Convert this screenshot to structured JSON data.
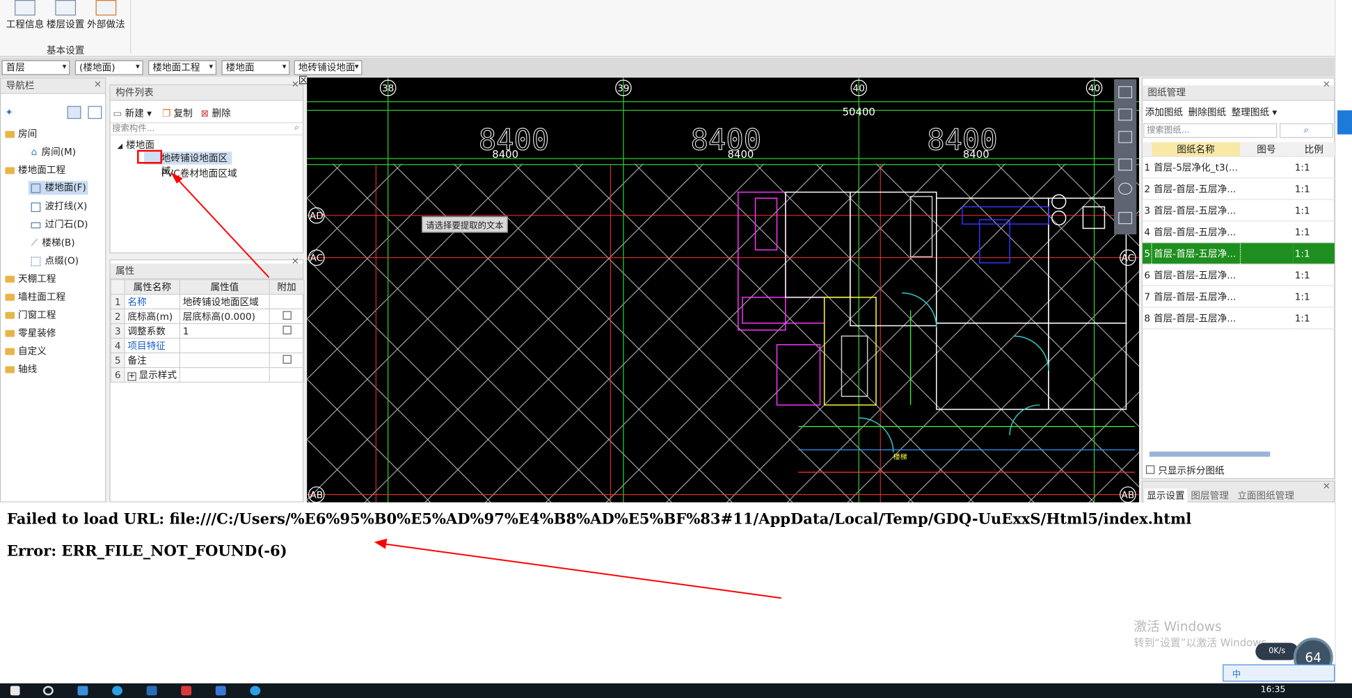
{
  "ribbon": {
    "buttons": [
      {
        "label": "工程信息",
        "icon": "project-info-icon"
      },
      {
        "label": "楼层设置",
        "icon": "floor-settings-icon"
      },
      {
        "label": "外部做法",
        "icon": "external-method-icon"
      }
    ],
    "group_label": "基本设置"
  },
  "selectors": [
    "首层",
    "(楼地面)",
    "楼地面工程",
    "楼地面",
    "地砖铺设地面区"
  ],
  "nav": {
    "title": "导航栏",
    "items": [
      {
        "label": "房间",
        "type": "category"
      },
      {
        "label": "房间(M)",
        "type": "sub"
      },
      {
        "label": "楼地面工程",
        "type": "category"
      },
      {
        "label": "楼地面(F)",
        "type": "sub",
        "selected": true
      },
      {
        "label": "波打线(X)",
        "type": "sub"
      },
      {
        "label": "过门石(D)",
        "type": "sub"
      },
      {
        "label": "楼梯(B)",
        "type": "sub"
      },
      {
        "label": "点缀(O)",
        "type": "sub"
      },
      {
        "label": "天棚工程",
        "type": "category"
      },
      {
        "label": "墙柱面工程",
        "type": "category"
      },
      {
        "label": "门窗工程",
        "type": "category"
      },
      {
        "label": "零星装修",
        "type": "category"
      },
      {
        "label": "自定义",
        "type": "category"
      },
      {
        "label": "轴线",
        "type": "category"
      }
    ]
  },
  "components": {
    "title": "构件列表",
    "toolbar": {
      "new": "新建",
      "copy": "复制",
      "delete": "删除"
    },
    "search_placeholder": "搜索构件...",
    "tree_root": "楼地面",
    "tree_items": [
      "地砖铺设地面区域",
      "PVC卷材地面区域"
    ]
  },
  "properties": {
    "title": "属性",
    "headers": [
      "属性名称",
      "属性值",
      "附加"
    ],
    "rows": [
      {
        "n": "1",
        "name": "名称",
        "value": "地砖铺设地面区域",
        "check": false,
        "blue": true
      },
      {
        "n": "2",
        "name": "底标高(m)",
        "value": "层底标高(0.000)",
        "check": true,
        "blue": false
      },
      {
        "n": "3",
        "name": "调整系数",
        "value": "1",
        "check": true,
        "blue": false
      },
      {
        "n": "4",
        "name": "项目特征",
        "value": "",
        "check": false,
        "blue": true
      },
      {
        "n": "5",
        "name": "备注",
        "value": "",
        "check": true,
        "blue": false
      },
      {
        "n": "6",
        "name": "显示样式",
        "value": "",
        "check": false,
        "blue": false,
        "expand": true
      }
    ]
  },
  "cad": {
    "axis_top": [
      "38",
      "39",
      "40",
      "40"
    ],
    "overall_dim": "50400",
    "big_dims": [
      "8400",
      "8400",
      "8400"
    ],
    "small_dims": [
      "8400",
      "8400",
      "8400"
    ],
    "row_labels": [
      "AD",
      "AC",
      "AC",
      "AB",
      "AB"
    ],
    "tooltip": "请选择要提取的文本"
  },
  "drawings": {
    "title": "图纸管理",
    "toolbar": {
      "add": "添加图纸",
      "delete": "删除图纸",
      "organize": "整理图纸"
    },
    "search_placeholder": "搜索图纸...",
    "headers": [
      "图纸名称",
      "图号",
      "比例"
    ],
    "rows": [
      {
        "n": "1",
        "name": "首层-5层净化_t3(...",
        "scale": "1:1"
      },
      {
        "n": "2",
        "name": "首层-首层-五层净...",
        "scale": "1:1"
      },
      {
        "n": "3",
        "name": "首层-首层-五层净...",
        "scale": "1:1"
      },
      {
        "n": "4",
        "name": "首层-首层-五层净...",
        "scale": "1:1"
      },
      {
        "n": "5",
        "name": "首层-首层-五层净...",
        "scale": "1:1",
        "selected": true
      },
      {
        "n": "6",
        "name": "首层-首层-五层净...",
        "scale": "1:1"
      },
      {
        "n": "7",
        "name": "首层-首层-五层净...",
        "scale": "1:1"
      },
      {
        "n": "8",
        "name": "首层-首层-五层净...",
        "scale": "1:1"
      }
    ],
    "split_only_label": "只显示拆分图纸",
    "tabs": [
      "显示设置",
      "图层管理",
      "立面图纸管理"
    ]
  },
  "error": {
    "line1": "Failed to load URL: file:///C:/Users/%E6%95%B0%E5%AD%97%E4%B8%AD%E5%BF%83#11/AppData/Local/Temp/GDQ-UuExxS/Html5/index.html",
    "line2": "Error: ERR_FILE_NOT_FOUND(-6)"
  },
  "watermark": {
    "line1": "激活 Windows",
    "line2": "转到“设置”以激活 Windows。"
  },
  "tray": {
    "speed": "0K/s",
    "percent": "64",
    "time": "16:35"
  },
  "colors": {
    "accent_green": "#1e8f1e",
    "annotation_red": "#ff0000",
    "cad_bg": "#000000"
  }
}
